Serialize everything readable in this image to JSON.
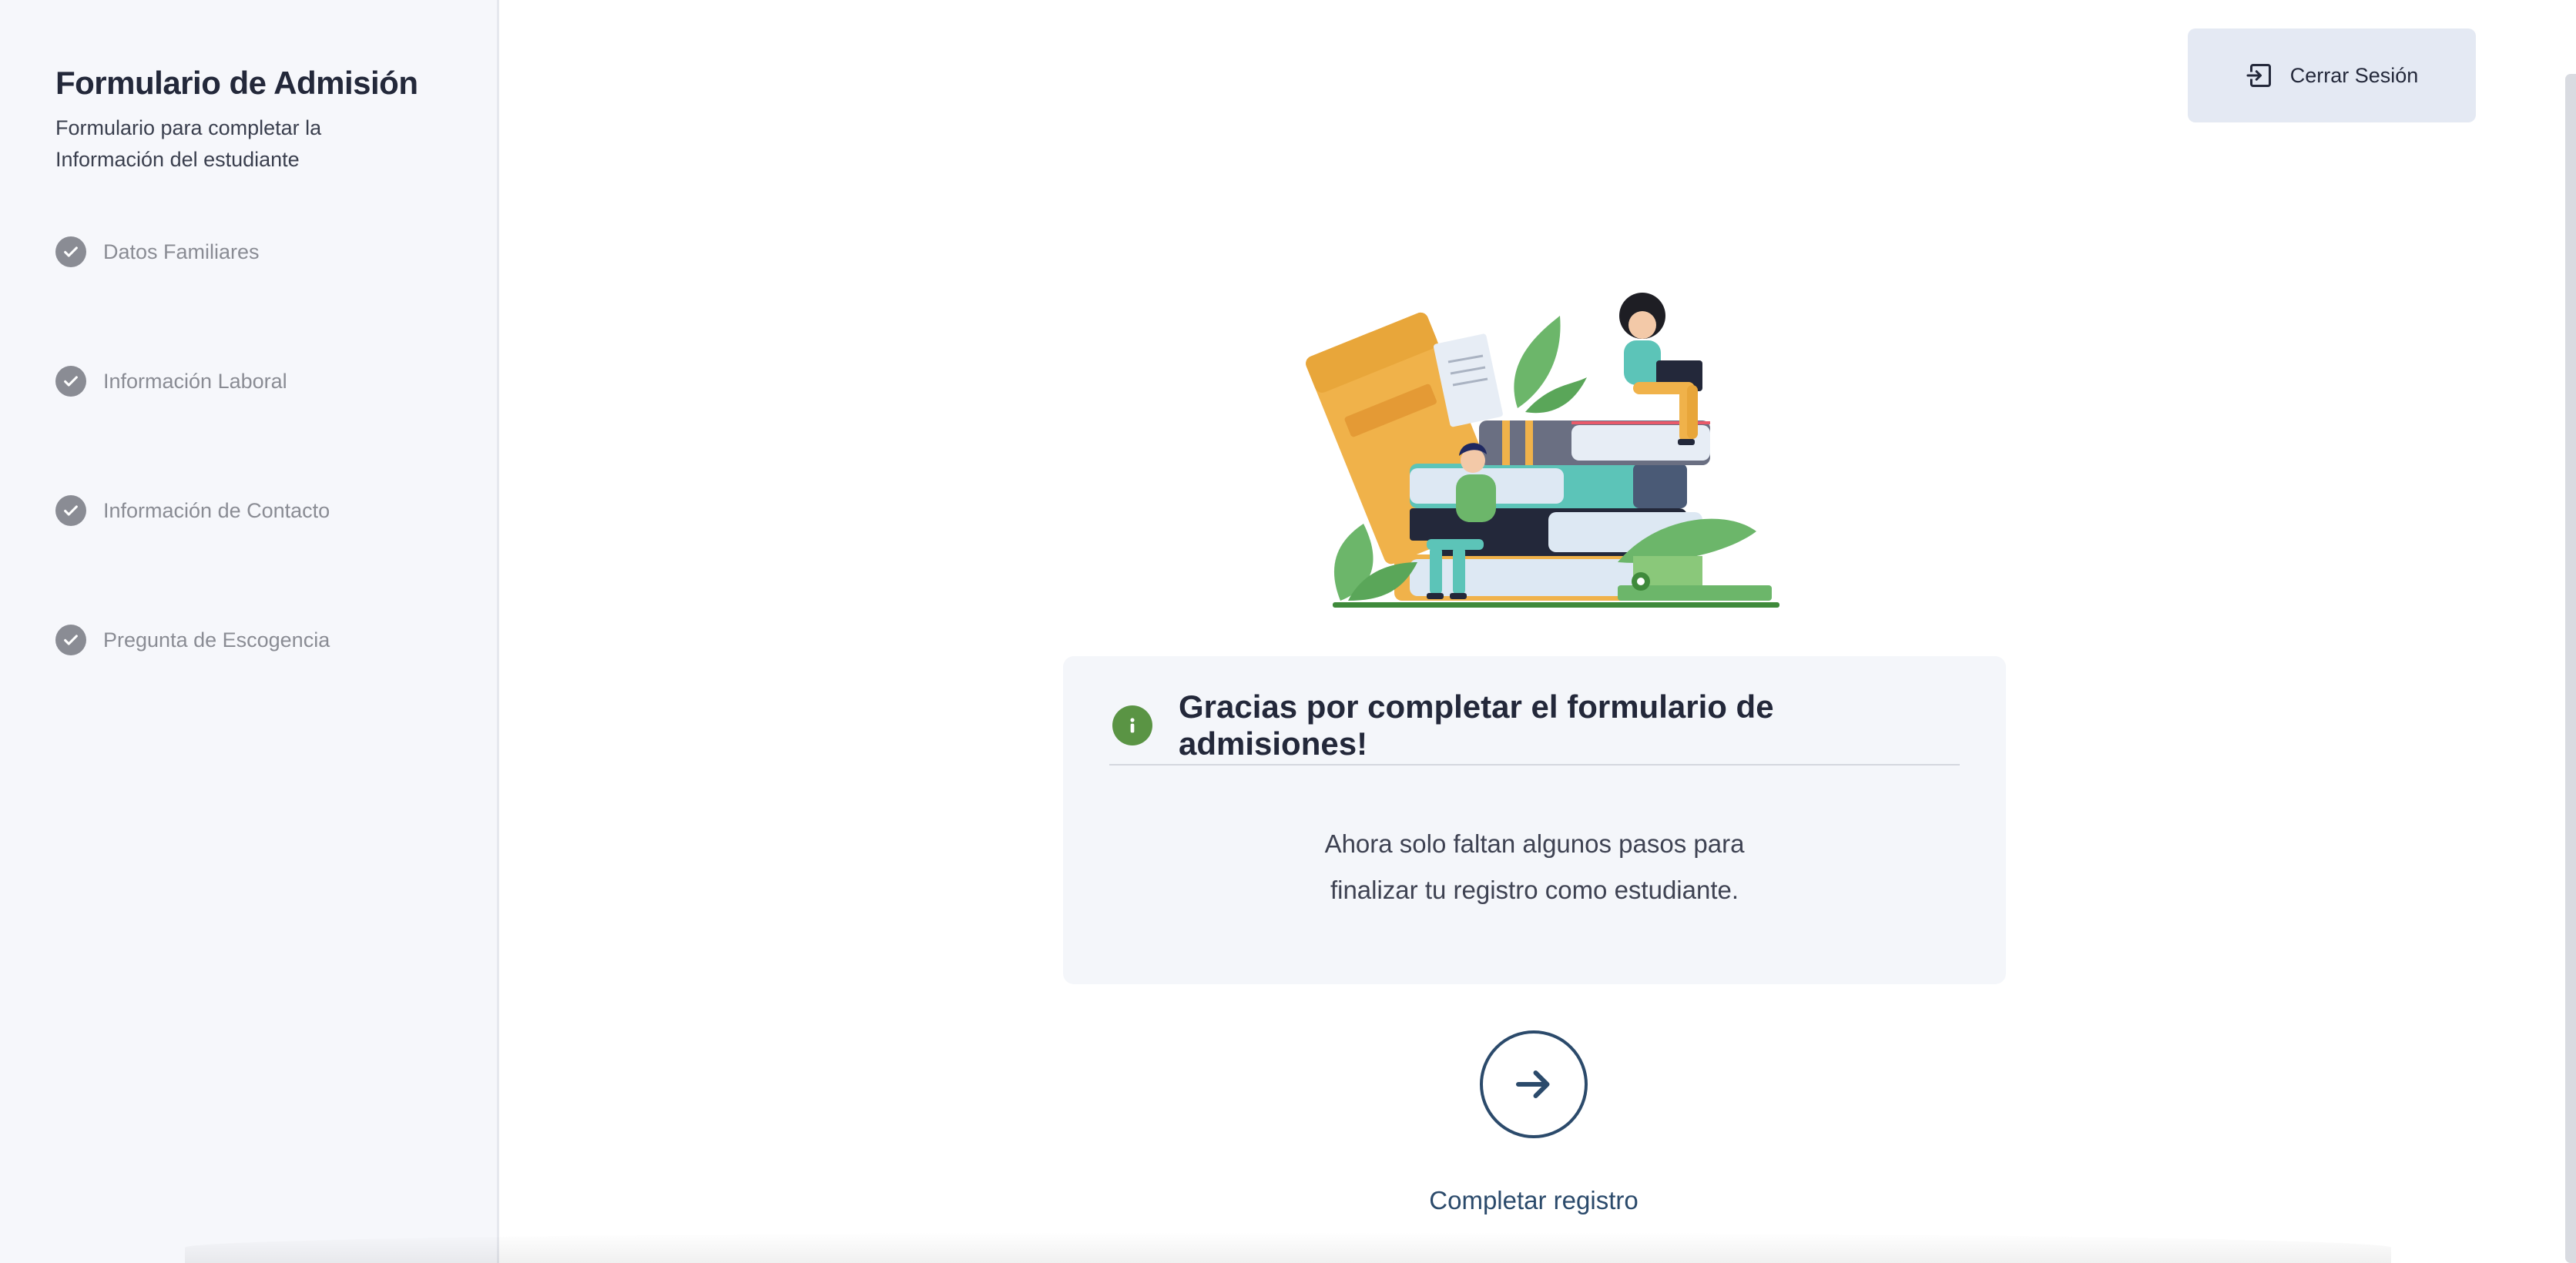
{
  "sidebar": {
    "title": "Formulario de Admisión",
    "subtitle": "Formulario para completar la Información del estudiante",
    "steps": [
      {
        "label": "Datos Familiares",
        "status": "completed"
      },
      {
        "label": "Información Laboral",
        "status": "completed"
      },
      {
        "label": "Información de Contacto",
        "status": "completed"
      },
      {
        "label": "Pregunta de Escogencia",
        "status": "completed"
      }
    ]
  },
  "header": {
    "logout_label": "Cerrar Sesión",
    "logout_icon": "sign-out-icon"
  },
  "card": {
    "icon": "info-icon",
    "title": "Gracias por completar el formulario de admisiones!",
    "line1": "Ahora solo faltan algunos pasos para",
    "line2": "finalizar tu registro como estudiante."
  },
  "action": {
    "icon": "arrow-right-icon",
    "label": "Completar registro"
  },
  "colors": {
    "sidebar_bg": "#f6f7fb",
    "step_gray": "#8a8c94",
    "info_green": "#5a9444",
    "primary_blue": "#2b4a6b",
    "logout_bg": "#e4e9f3",
    "card_bg": "#f4f6fa"
  }
}
